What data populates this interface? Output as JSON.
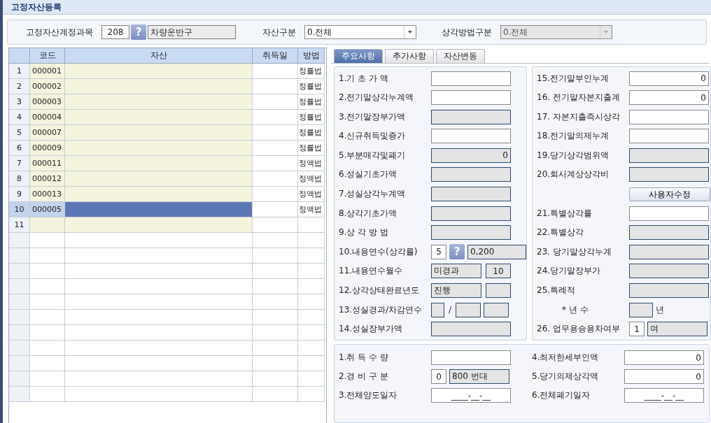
{
  "window": {
    "title": "고정자산등록"
  },
  "filters": [
    {
      "label": "고정자산계정과목",
      "kind": "code",
      "code": "208",
      "help": "?",
      "value": "차량운반구"
    },
    {
      "label": "자산구분",
      "kind": "select",
      "value": "0.전체",
      "disabled": false
    },
    {
      "label": "상각방법구분",
      "kind": "select",
      "value": "0.전체",
      "disabled": true
    }
  ],
  "grid": {
    "columns": [
      "코드",
      "자산",
      "취득일",
      "방법"
    ],
    "rows": [
      {
        "num": "1",
        "code": "000001",
        "method": "정률법",
        "selected": false
      },
      {
        "num": "2",
        "code": "000002",
        "method": "정률법",
        "selected": false
      },
      {
        "num": "3",
        "code": "000003",
        "method": "정률법",
        "selected": false
      },
      {
        "num": "4",
        "code": "000004",
        "method": "정률법",
        "selected": false
      },
      {
        "num": "5",
        "code": "000007",
        "method": "정률법",
        "selected": false
      },
      {
        "num": "6",
        "code": "000009",
        "method": "정률법",
        "selected": false
      },
      {
        "num": "7",
        "code": "000011",
        "method": "정액법",
        "selected": false
      },
      {
        "num": "8",
        "code": "000012",
        "method": "정액법",
        "selected": false
      },
      {
        "num": "9",
        "code": "000013",
        "method": "정액법",
        "selected": false
      },
      {
        "num": "10",
        "code": "000005",
        "method": "정액법",
        "selected": true
      },
      {
        "num": "11",
        "selected": false
      }
    ]
  },
  "tabs": [
    {
      "label": "주요사항",
      "selected": true
    },
    {
      "label": "추가사항",
      "selected": false
    },
    {
      "label": "자산변동",
      "selected": false
    }
  ],
  "main_left": [
    {
      "label": "1.기 초 가 액",
      "kind": "amount",
      "readonly": false
    },
    {
      "label": "2.전기말상각누계액",
      "kind": "amount",
      "readonly": false
    },
    {
      "label": "3.전기말장부가액",
      "kind": "amount",
      "readonly": true
    },
    {
      "label": "4.신규취득및증가",
      "kind": "amount",
      "readonly": false
    },
    {
      "label": "5.부분매각및폐기",
      "kind": "amount",
      "readonly": true,
      "value": "0"
    },
    {
      "label": "6.성실기초가액",
      "kind": "amount",
      "readonly": true
    },
    {
      "label": "7.성실상각누계액",
      "kind": "amount",
      "readonly": true
    },
    {
      "label": "8.상각기초가액",
      "kind": "amount",
      "readonly": true
    },
    {
      "label": "9.상 각 방 법",
      "kind": "amount",
      "readonly": true
    },
    {
      "label": "10.내용연수(상각률)",
      "kind": "code_name",
      "code": "5",
      "help": "?",
      "value": "0,200"
    },
    {
      "label": "11.내용연수월수",
      "kind": "pair",
      "value": "미경과",
      "value2": "10"
    },
    {
      "label": "12.상각상태완료년도",
      "kind": "pair",
      "value": "진행"
    },
    {
      "label": "13.성실경과/차감연수",
      "kind": "split",
      "separator": "/"
    },
    {
      "label": "14.성실장부가액",
      "kind": "amount",
      "readonly": true
    }
  ],
  "main_right": [
    {
      "label": "15.전기말부인누계",
      "kind": "amount",
      "readonly": false,
      "value": "0"
    },
    {
      "label": "16. 전기말자본지출계",
      "kind": "amount",
      "readonly": false,
      "value": "0"
    },
    {
      "label": "17. 자본지출즉시상각",
      "kind": "amount",
      "readonly": false
    },
    {
      "label": "18.전기말의제누계",
      "kind": "amount",
      "readonly": false
    },
    {
      "label": "19.당기상각범위액",
      "kind": "amount",
      "readonly": true
    },
    {
      "label": "20.회사계상상각비",
      "kind": "amount",
      "readonly": true
    },
    {
      "kind": "button",
      "value": "사용자수정"
    },
    {
      "label": "21.특별상각률",
      "kind": "amount",
      "readonly": false
    },
    {
      "label": "22.특별상각",
      "kind": "amount",
      "readonly": true
    },
    {
      "label": "23. 당기말상각누계",
      "kind": "amount",
      "readonly": true
    },
    {
      "label": "24.당기말장부가",
      "kind": "amount",
      "readonly": true
    },
    {
      "label": "25.특례적",
      "kind": "amount",
      "readonly": true
    },
    {
      "label": "* 년 수",
      "kind": "years",
      "suffix": "년"
    },
    {
      "label": "26. 업무용승용차여부",
      "kind": "code_name",
      "code": "1",
      "value": "여"
    }
  ],
  "extra_left": [
    {
      "label": "1.취 득 수 량",
      "kind": "amount",
      "readonly": false
    },
    {
      "label": "2.경 비 구 분",
      "kind": "code_name",
      "code": "0",
      "value": "800 번대"
    },
    {
      "label": "3.전체양도일자",
      "kind": "date",
      "readonly": false,
      "value": "____-__-__"
    }
  ],
  "extra_right": [
    {
      "label": "4.최저한세부인액",
      "kind": "amount",
      "readonly": false,
      "value": "0"
    },
    {
      "label": "5.당기의제상각액",
      "kind": "amount",
      "readonly": false,
      "value": "0"
    },
    {
      "label": "6.전체폐기일자",
      "kind": "date",
      "readonly": false,
      "value": "____-__-__"
    }
  ]
}
